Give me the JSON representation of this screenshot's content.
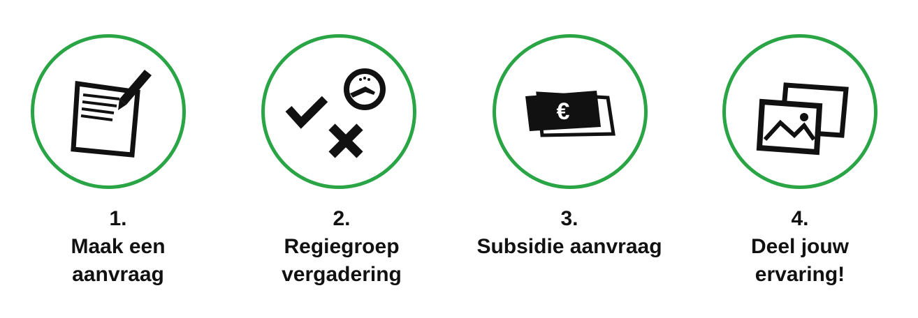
{
  "accent_color": "#2aa545",
  "steps": [
    {
      "number": "1.",
      "line1": "Maak een",
      "line2": "aanvraag",
      "icon": "document-pen-icon"
    },
    {
      "number": "2.",
      "line1": "Regiegroep",
      "line2": "vergadering",
      "icon": "check-cross-clock-icon"
    },
    {
      "number": "3.",
      "line1": "Subsidie aanvraag",
      "line2": "",
      "icon": "euro-banknotes-icon",
      "currency_symbol": "€"
    },
    {
      "number": "4.",
      "line1": "Deel jouw",
      "line2": "ervaring!",
      "icon": "photos-icon"
    }
  ]
}
